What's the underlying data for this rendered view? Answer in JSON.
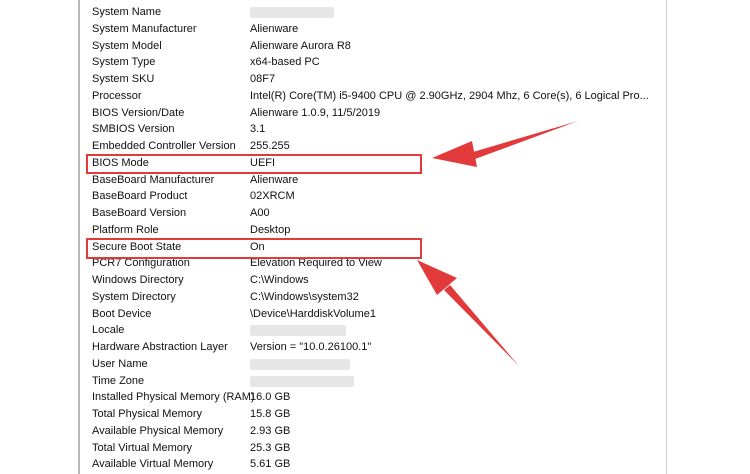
{
  "colors": {
    "annotation": "#e23a3a",
    "redaction": "#e6e6e6"
  },
  "rows": [
    {
      "item": "System Name",
      "value": null
    },
    {
      "item": "System Manufacturer",
      "value": "Alienware"
    },
    {
      "item": "System Model",
      "value": "Alienware Aurora R8"
    },
    {
      "item": "System Type",
      "value": "x64-based PC"
    },
    {
      "item": "System SKU",
      "value": "08F7"
    },
    {
      "item": "Processor",
      "value": "Intel(R) Core(TM) i5-9400 CPU @ 2.90GHz, 2904 Mhz, 6 Core(s), 6 Logical Pro..."
    },
    {
      "item": "BIOS Version/Date",
      "value": "Alienware 1.0.9, 11/5/2019"
    },
    {
      "item": "SMBIOS Version",
      "value": "3.1"
    },
    {
      "item": "Embedded Controller Version",
      "value": "255.255"
    },
    {
      "item": "BIOS Mode",
      "value": "UEFI"
    },
    {
      "item": "BaseBoard Manufacturer",
      "value": "Alienware"
    },
    {
      "item": "BaseBoard Product",
      "value": "02XRCM"
    },
    {
      "item": "BaseBoard Version",
      "value": "A00"
    },
    {
      "item": "Platform Role",
      "value": "Desktop"
    },
    {
      "item": "Secure Boot State",
      "value": "On"
    },
    {
      "item": "PCR7 Configuration",
      "value": "Elevation Required to View"
    },
    {
      "item": "Windows Directory",
      "value": "C:\\Windows"
    },
    {
      "item": "System Directory",
      "value": "C:\\Windows\\system32"
    },
    {
      "item": "Boot Device",
      "value": "\\Device\\HarddiskVolume1"
    },
    {
      "item": "Locale",
      "value": null
    },
    {
      "item": "Hardware Abstraction Layer",
      "value": "Version = \"10.0.26100.1\""
    },
    {
      "item": "User Name",
      "value": null
    },
    {
      "item": "Time Zone",
      "value": null
    },
    {
      "item": "Installed Physical Memory (RAM)",
      "value": "16.0 GB"
    },
    {
      "item": "Total Physical Memory",
      "value": "15.8 GB"
    },
    {
      "item": "Available Physical Memory",
      "value": "2.93 GB"
    },
    {
      "item": "Total Virtual Memory",
      "value": "25.3 GB"
    },
    {
      "item": "Available Virtual Memory",
      "value": "5.61 GB"
    }
  ]
}
